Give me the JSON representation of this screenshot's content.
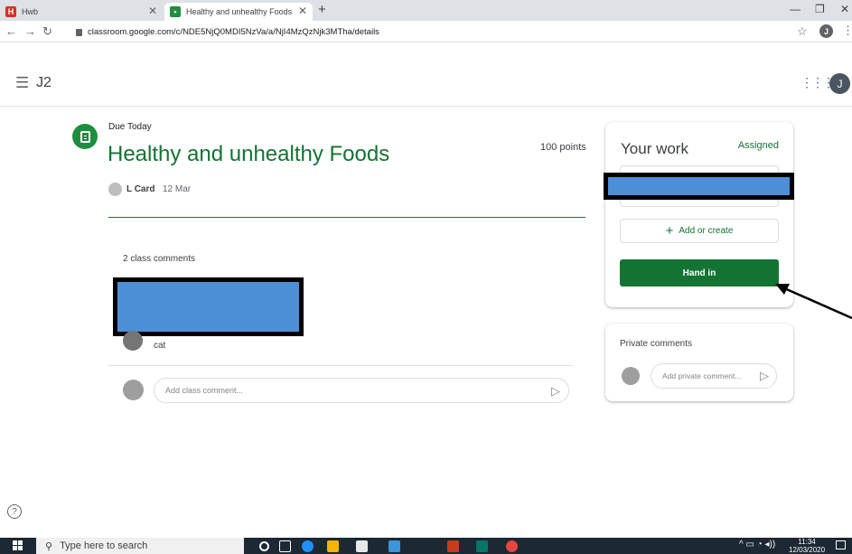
{
  "browser": {
    "tabs": [
      {
        "favicon": "H",
        "label": "Hwb",
        "favicon_color": "#d93025"
      },
      {
        "favicon": "",
        "label": "Healthy and unhealthy Foods",
        "favicon_color": "#1e8e3e"
      }
    ],
    "new_tab": "+",
    "url": "classroom.google.com/c/NDE5NjQ0MDI5NzVa/a/NjI4MzQzNjk3MTha/details",
    "profile_initial": "J"
  },
  "header": {
    "class_name": "J2",
    "avatar_initial": "J"
  },
  "assignment": {
    "due": "Due Today",
    "title": "Healthy and unhealthy Foods",
    "points": "100 points",
    "author": "L Card",
    "date": "12 Mar",
    "comments_count": "2 class comments",
    "comment_text": "cat",
    "comment_placeholder": "Add class comment..."
  },
  "your_work": {
    "title": "Your work",
    "status": "Assigned",
    "add_label": "Add or create",
    "hand_in_label": "Hand in"
  },
  "private_comments": {
    "title": "Private comments",
    "placeholder": "Add private comment..."
  },
  "taskbar": {
    "search_placeholder": "Type here to search",
    "time": "11:34",
    "date": "12/03/2020"
  },
  "colors": {
    "classroom_green": "#137333",
    "redaction_blue": "#4d8fd6"
  }
}
